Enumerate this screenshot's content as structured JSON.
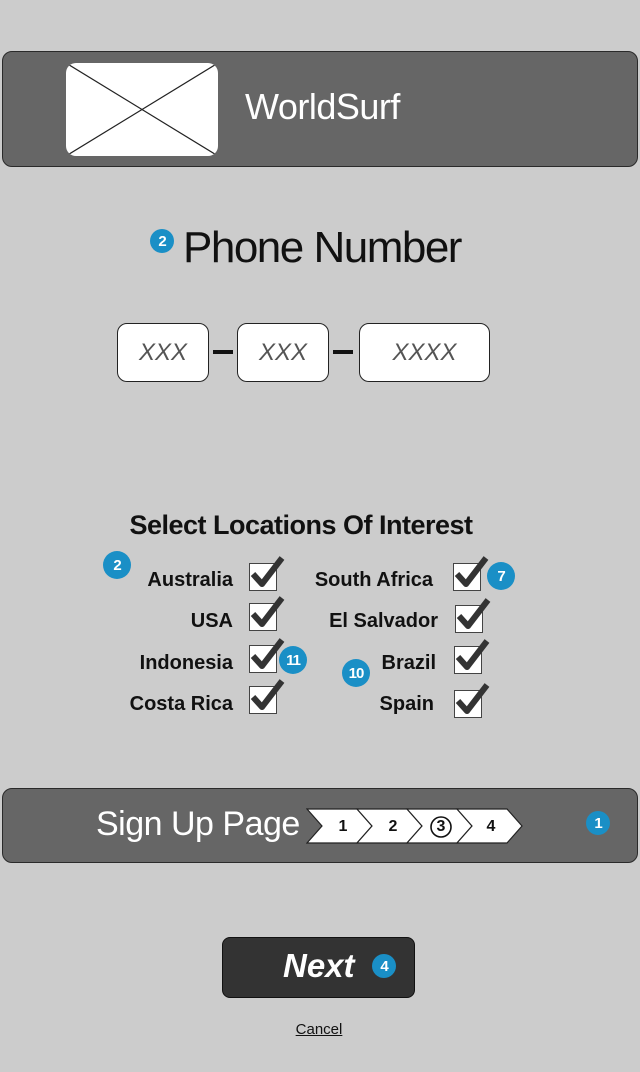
{
  "header": {
    "app_title": "WorldSurf",
    "logo_icon": "image-placeholder-icon"
  },
  "phone": {
    "badge": "2",
    "title": "Phone Number",
    "fields": [
      {
        "placeholder": "XXX"
      },
      {
        "placeholder": "XXX"
      },
      {
        "placeholder": "XXXX"
      }
    ]
  },
  "locations": {
    "title": "Select Locations Of Interest",
    "badge": "2",
    "left": [
      {
        "label": "Australia",
        "checked": true
      },
      {
        "label": "USA",
        "checked": true
      },
      {
        "label": "Indonesia",
        "checked": true
      },
      {
        "label": "Costa Rica",
        "checked": true
      }
    ],
    "right": [
      {
        "label": "South Africa",
        "checked": true
      },
      {
        "label": "El Salvador",
        "checked": true
      },
      {
        "label": "Brazil",
        "checked": true
      },
      {
        "label": "Spain",
        "checked": true
      }
    ],
    "badges": {
      "south_africa": "7",
      "indonesia": "11",
      "brazil": "10"
    }
  },
  "progress": {
    "label": "Sign Up Page",
    "steps": [
      "1",
      "2",
      "3",
      "4"
    ],
    "current_step": "3",
    "badge": "1"
  },
  "actions": {
    "next_label": "Next",
    "next_badge": "4",
    "cancel_label": "Cancel"
  },
  "colors": {
    "background": "#cccccc",
    "bar": "#666666",
    "button": "#333333",
    "badge": "#1a8fc6"
  }
}
